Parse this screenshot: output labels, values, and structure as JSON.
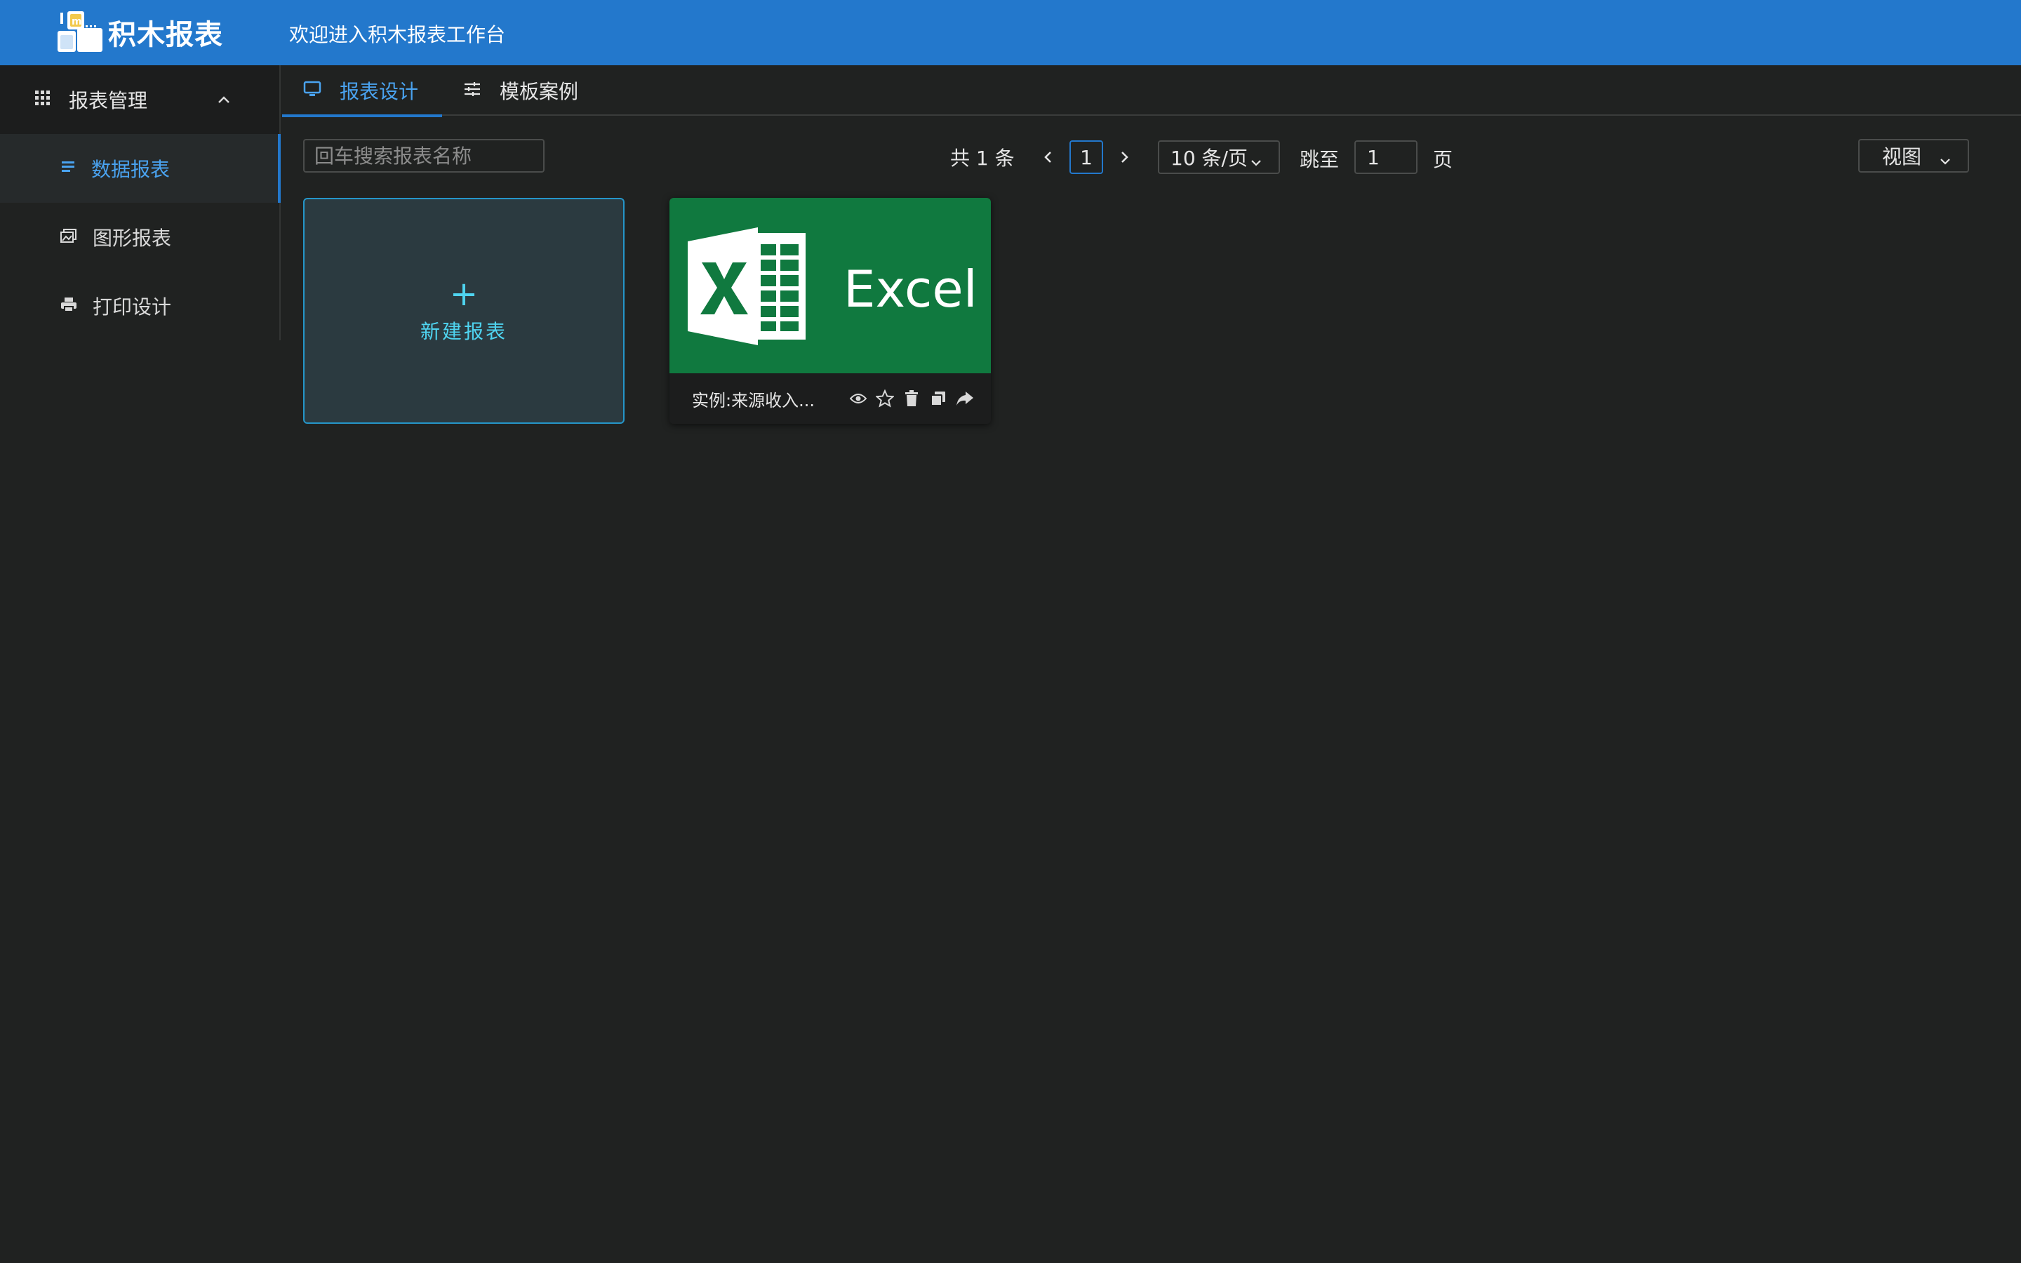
{
  "header": {
    "logo_text": "积木报表",
    "welcome": "欢迎进入积木报表工作台",
    "bg_color": "#2378cc"
  },
  "sidebar": {
    "group_label": "报表管理",
    "items": [
      {
        "label": "数据报表",
        "icon": "list-icon",
        "active": true
      },
      {
        "label": "图形报表",
        "icon": "image-icon",
        "active": false
      },
      {
        "label": "打印设计",
        "icon": "printer-icon",
        "active": false
      }
    ]
  },
  "tabs": [
    {
      "label": "报表设计",
      "icon": "monitor-icon",
      "active": true
    },
    {
      "label": "模板案例",
      "icon": "sliders-icon",
      "active": false
    }
  ],
  "toolbar": {
    "search_placeholder": "回车搜索报表名称",
    "total": "共 1 条",
    "current_page": "1",
    "page_size": "10 条/页",
    "jump_label": "跳至",
    "jump_value": "1",
    "page_label": "页",
    "view_label": "视图"
  },
  "cards": {
    "new_label": "新建报表",
    "new_plus": "+",
    "report": {
      "title": "实例:来源收入...",
      "thumb_text": "Excel",
      "thumb_color": "#10793f",
      "actions": [
        "eye-icon",
        "star-icon",
        "trash-icon",
        "copy-icon",
        "share-icon"
      ]
    }
  }
}
